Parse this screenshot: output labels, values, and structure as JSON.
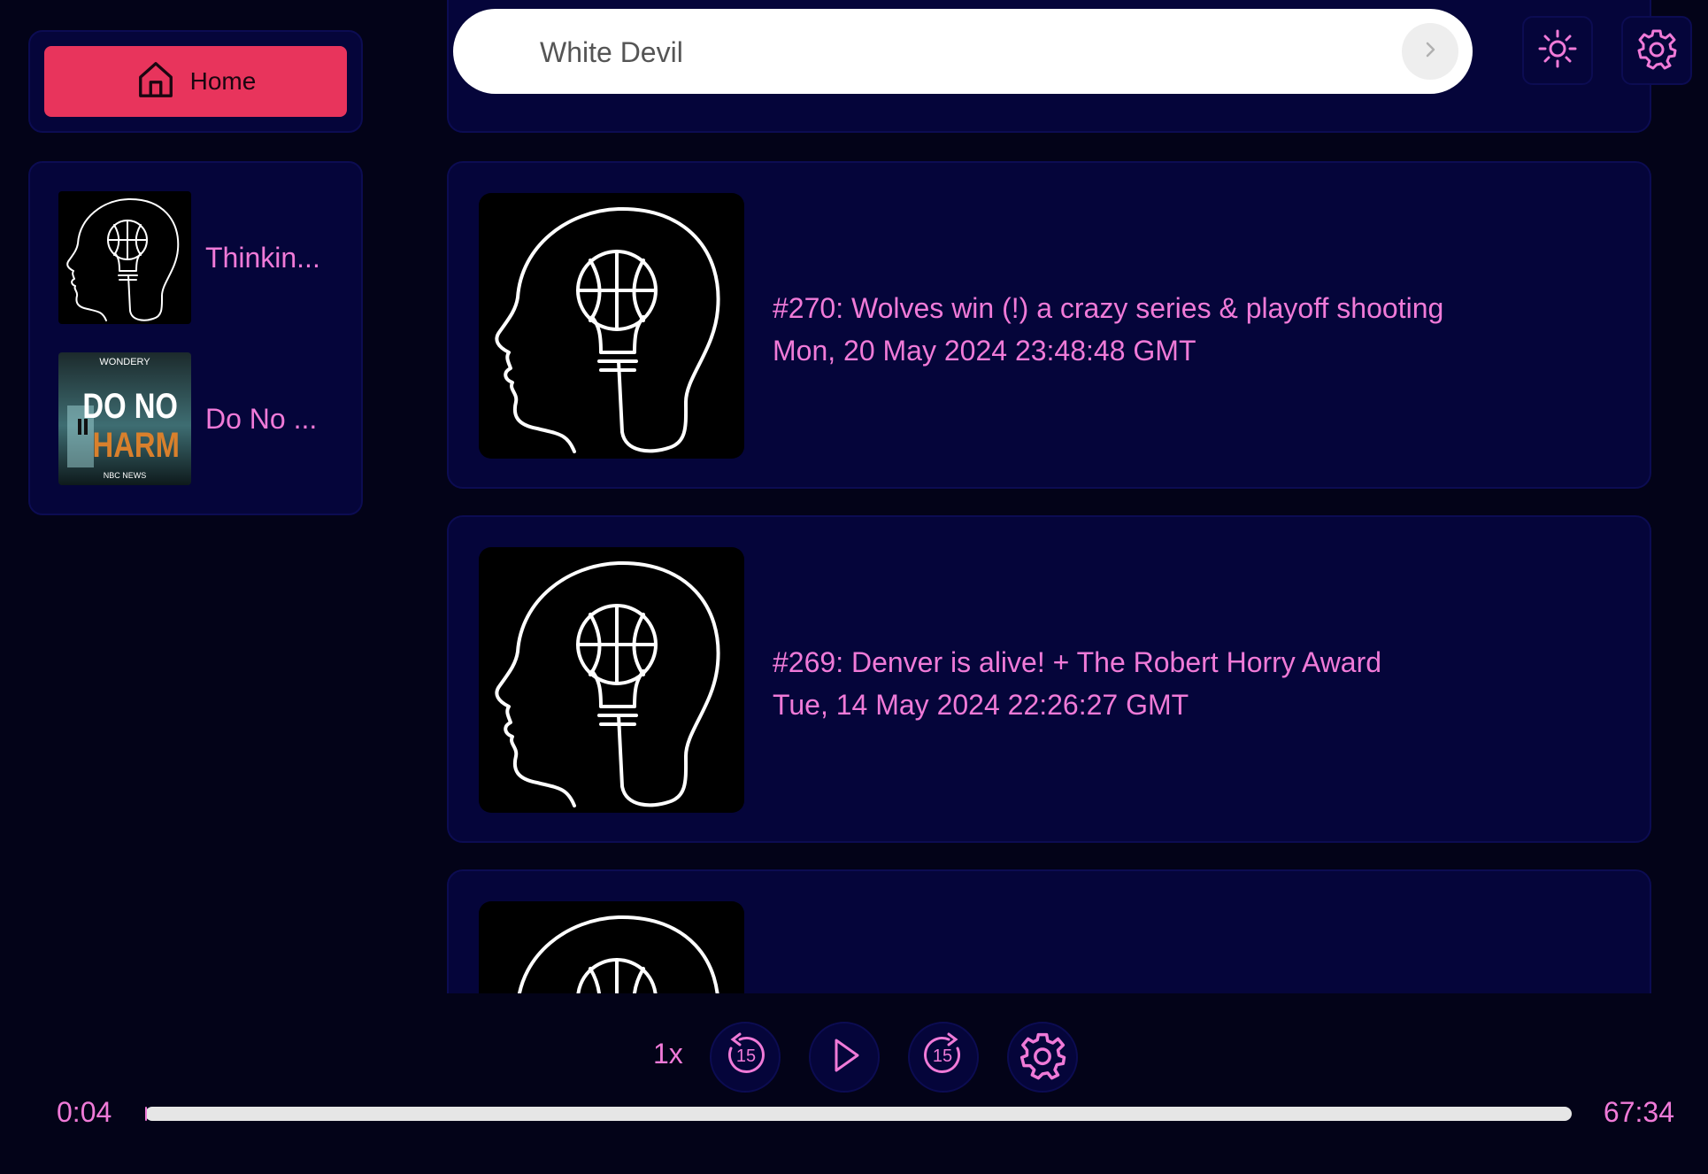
{
  "nav": {
    "home_label": "Home"
  },
  "sidebar": {
    "items": [
      {
        "label": "Thinkin...",
        "art": "thinking-basketball-art"
      },
      {
        "label": "Do No ...",
        "art": "do-no-harm-art",
        "art_text": {
          "publisher": "WONDERY",
          "line1": "DO NO",
          "line2": "HARM",
          "network": "NBC NEWS"
        }
      }
    ]
  },
  "search": {
    "value": "White Devil",
    "go_icon": "chevron-right-icon"
  },
  "toolbar": {
    "theme_icon": "sun-icon",
    "settings_icon": "gear-icon"
  },
  "episodes": [
    {
      "title": "#270: Wolves win (!) a crazy series & playoff shooting",
      "date": "Mon, 20 May 2024 23:48:48 GMT"
    },
    {
      "title": "#269: Denver is alive! + The Robert Horry Award",
      "date": "Tue, 14 May 2024 22:26:27 GMT"
    }
  ],
  "player": {
    "speed": "1x",
    "rewind_seconds": "15",
    "forward_seconds": "15",
    "current_time": "0:04",
    "total_time": "67:34",
    "progress_fraction": 0.001
  },
  "colors": {
    "accent": "#e8345c",
    "text": "#f07ad8",
    "background": "#030318",
    "panel": "#05053a"
  }
}
